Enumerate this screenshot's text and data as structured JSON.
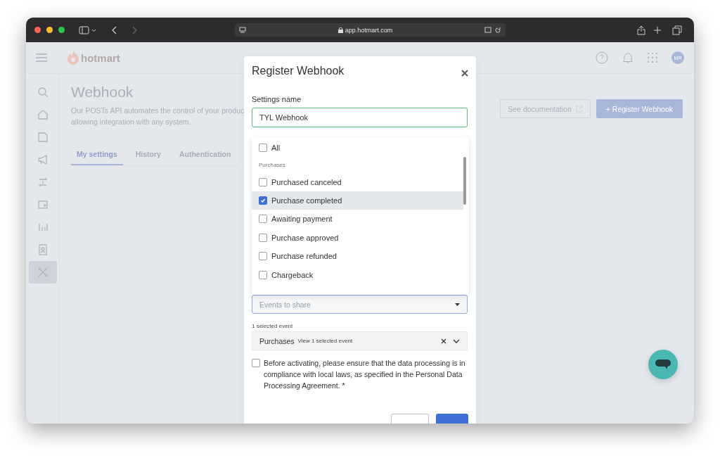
{
  "browser": {
    "url": "app.hotmart.com"
  },
  "header": {
    "logo_text": "hotmart",
    "avatar": "MR"
  },
  "sidebar": {
    "items": [
      {
        "kind": "search",
        "selected": false
      },
      {
        "kind": "home",
        "selected": false
      },
      {
        "kind": "folder",
        "selected": false
      },
      {
        "kind": "megaphone",
        "selected": false
      },
      {
        "kind": "exchange",
        "selected": false
      },
      {
        "kind": "wallet",
        "selected": false
      },
      {
        "kind": "chart",
        "selected": false
      },
      {
        "kind": "contact",
        "selected": false
      },
      {
        "kind": "tools",
        "selected": true
      }
    ]
  },
  "page": {
    "title": "Webhook",
    "description": [
      "Our POSTs API automates the control of your produc",
      "allowing integration with any system."
    ],
    "tabs": [
      {
        "label": "My settings",
        "selected": true
      },
      {
        "label": "History",
        "selected": false
      },
      {
        "label": "Authentication",
        "selected": false
      }
    ],
    "doc_button": "See documentation",
    "register_button": "+ Register Webhook"
  },
  "modal": {
    "title": "Register Webhook",
    "name_label": "Settings name",
    "name_value": "TYL Webhook",
    "events": [
      {
        "kind": "option",
        "label": "All",
        "checked": false,
        "highlighted": false
      },
      {
        "kind": "group",
        "label": "Purchases"
      },
      {
        "kind": "option",
        "label": "Purchased canceled",
        "checked": false,
        "highlighted": false
      },
      {
        "kind": "option",
        "label": "Purchase completed",
        "checked": true,
        "highlighted": true
      },
      {
        "kind": "option",
        "label": "Awaiting payment",
        "checked": false,
        "highlighted": false
      },
      {
        "kind": "option",
        "label": "Purchase approved",
        "checked": false,
        "highlighted": false
      },
      {
        "kind": "option",
        "label": "Purchase refunded",
        "checked": false,
        "highlighted": false
      },
      {
        "kind": "option",
        "label": "Chargeback",
        "checked": false,
        "highlighted": false
      }
    ],
    "events_placeholder": "Events to share",
    "selected_count": "1 selected event",
    "chip": {
      "group": "Purchases",
      "summary": "View 1 selected event"
    },
    "consent": {
      "checked": false,
      "text": "Before activating, please ensure that the data processing is in compliance with local laws, as specified in the Personal Data Processing Agreement. *"
    }
  }
}
